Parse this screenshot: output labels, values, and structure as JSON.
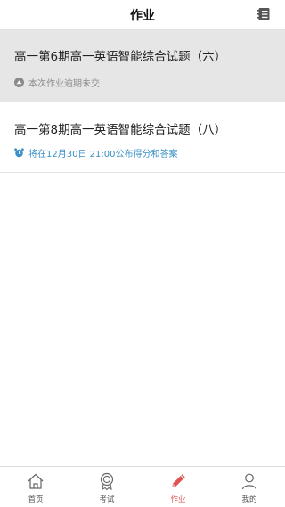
{
  "header": {
    "title": "作业",
    "menu_icon": "list-menu-icon"
  },
  "assignments": [
    {
      "title": "高一第6期高一英语智能综合试题（六）",
      "status": "本次作业逾期未交",
      "status_icon": "overdue-icon",
      "status_color": "#8a8a8a",
      "highlighted": true
    },
    {
      "title": "高一第8期高一英语智能综合试题（八）",
      "status": "将在12月30日 21:00公布得分和答案",
      "status_icon": "alarm-clock-icon",
      "status_color": "#3a8fc6",
      "highlighted": false
    }
  ],
  "tabbar": {
    "active_color": "#e05252",
    "items": [
      {
        "label": "首页",
        "icon": "home-icon",
        "active": false
      },
      {
        "label": "考试",
        "icon": "medal-icon",
        "active": false
      },
      {
        "label": "作业",
        "icon": "pencil-icon",
        "active": true
      },
      {
        "label": "我的",
        "icon": "person-icon",
        "active": false
      }
    ]
  }
}
